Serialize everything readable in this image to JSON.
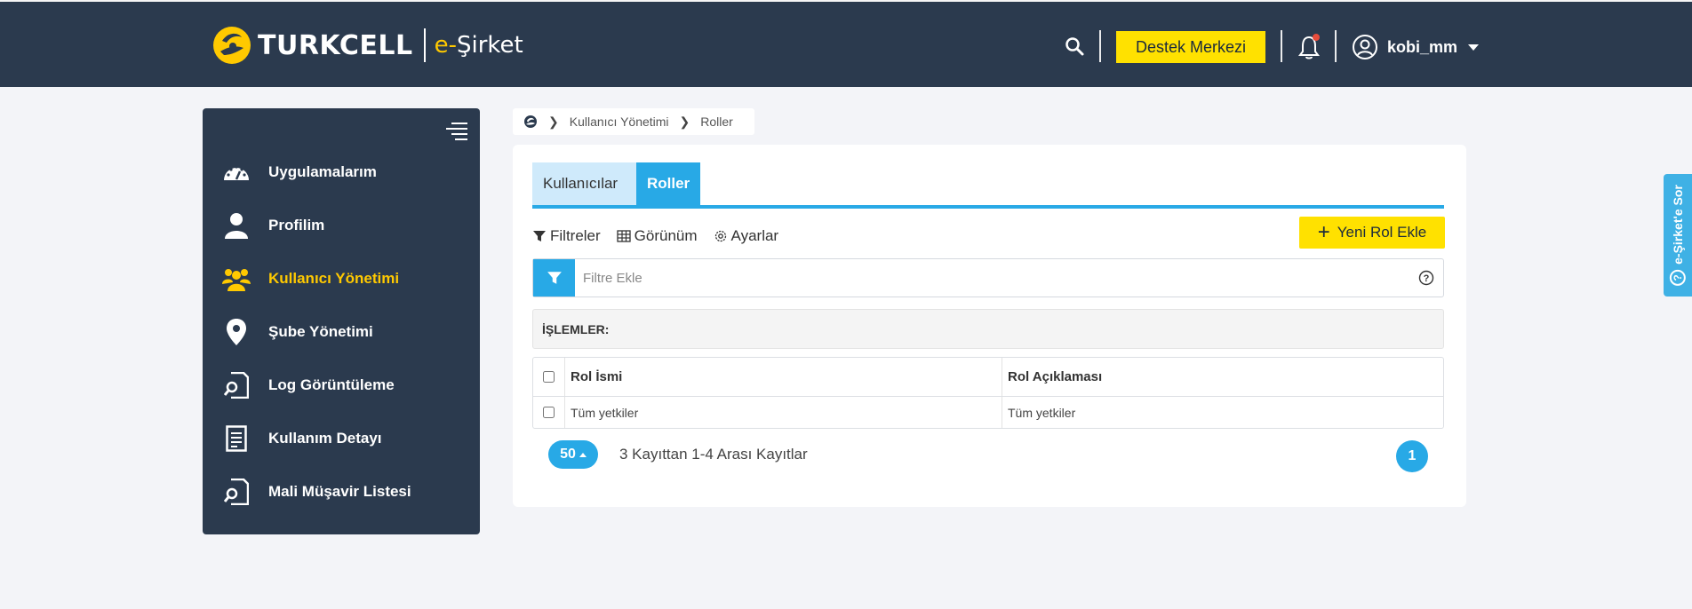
{
  "header": {
    "brand": "TURKCELL",
    "product_prefix": "e-",
    "product_name": "Şirket",
    "support_label": "Destek Merkezi",
    "user_name": "kobi_mm",
    "notification_dot_color": "#e74c3c"
  },
  "sidebar": {
    "items": [
      {
        "label": "Uygulamalarım",
        "icon": "dashboard-icon",
        "active": false
      },
      {
        "label": "Profilim",
        "icon": "user-icon",
        "active": false
      },
      {
        "label": "Kullanıcı Yönetimi",
        "icon": "users-icon",
        "active": true
      },
      {
        "label": "Şube Yönetimi",
        "icon": "location-pin-icon",
        "active": false
      },
      {
        "label": "Log Görüntüleme",
        "icon": "document-search-icon",
        "active": false
      },
      {
        "label": "Kullanım Detayı",
        "icon": "document-list-icon",
        "active": false
      },
      {
        "label": "Mali Müşavir Listesi",
        "icon": "document-search-icon",
        "active": false
      }
    ]
  },
  "breadcrumb": {
    "items": [
      "Kullanıcı Yönetimi",
      "Roller"
    ]
  },
  "tabs": [
    {
      "label": "Kullanıcılar",
      "active": false
    },
    {
      "label": "Roller",
      "active": true
    }
  ],
  "toolbar": {
    "filters_label": "Filtreler",
    "view_label": "Görünüm",
    "settings_label": "Ayarlar",
    "add_role_label": "Yeni Rol Ekle"
  },
  "filter": {
    "placeholder": "Filtre Ekle"
  },
  "operations": {
    "label": "İŞLEMLER:"
  },
  "table": {
    "columns": [
      "Rol İsmi",
      "Rol Açıklaması"
    ],
    "rows": [
      {
        "name": "Tüm yetkiler",
        "description": "Tüm yetkiler"
      }
    ]
  },
  "pagination": {
    "page_size": "50",
    "record_info": "3 Kayıttan 1-4 Arası Kayıtlar",
    "current_page": "1"
  },
  "side_tab": {
    "label": "e-Şirket'e Sor"
  },
  "colors": {
    "header_bg": "#2b3a4e",
    "accent_blue": "#28a9e6",
    "accent_yellow": "#ffe100",
    "active_menu": "#ffc900"
  }
}
